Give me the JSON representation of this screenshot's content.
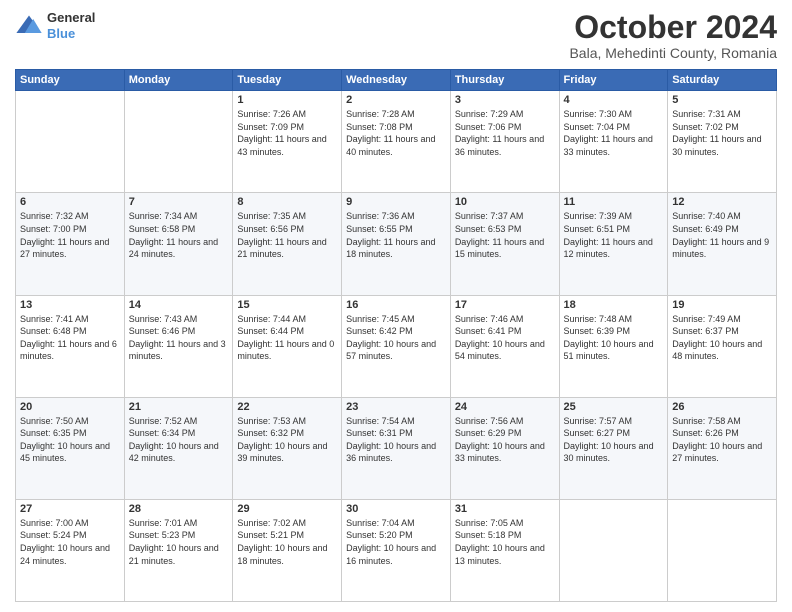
{
  "header": {
    "logo_line1": "General",
    "logo_line2": "Blue",
    "title": "October 2024",
    "location": "Bala, Mehedinti County, Romania"
  },
  "weekdays": [
    "Sunday",
    "Monday",
    "Tuesday",
    "Wednesday",
    "Thursday",
    "Friday",
    "Saturday"
  ],
  "weeks": [
    [
      {
        "day": "",
        "sunrise": "",
        "sunset": "",
        "daylight": ""
      },
      {
        "day": "",
        "sunrise": "",
        "sunset": "",
        "daylight": ""
      },
      {
        "day": "1",
        "sunrise": "Sunrise: 7:26 AM",
        "sunset": "Sunset: 7:09 PM",
        "daylight": "Daylight: 11 hours and 43 minutes."
      },
      {
        "day": "2",
        "sunrise": "Sunrise: 7:28 AM",
        "sunset": "Sunset: 7:08 PM",
        "daylight": "Daylight: 11 hours and 40 minutes."
      },
      {
        "day": "3",
        "sunrise": "Sunrise: 7:29 AM",
        "sunset": "Sunset: 7:06 PM",
        "daylight": "Daylight: 11 hours and 36 minutes."
      },
      {
        "day": "4",
        "sunrise": "Sunrise: 7:30 AM",
        "sunset": "Sunset: 7:04 PM",
        "daylight": "Daylight: 11 hours and 33 minutes."
      },
      {
        "day": "5",
        "sunrise": "Sunrise: 7:31 AM",
        "sunset": "Sunset: 7:02 PM",
        "daylight": "Daylight: 11 hours and 30 minutes."
      }
    ],
    [
      {
        "day": "6",
        "sunrise": "Sunrise: 7:32 AM",
        "sunset": "Sunset: 7:00 PM",
        "daylight": "Daylight: 11 hours and 27 minutes."
      },
      {
        "day": "7",
        "sunrise": "Sunrise: 7:34 AM",
        "sunset": "Sunset: 6:58 PM",
        "daylight": "Daylight: 11 hours and 24 minutes."
      },
      {
        "day": "8",
        "sunrise": "Sunrise: 7:35 AM",
        "sunset": "Sunset: 6:56 PM",
        "daylight": "Daylight: 11 hours and 21 minutes."
      },
      {
        "day": "9",
        "sunrise": "Sunrise: 7:36 AM",
        "sunset": "Sunset: 6:55 PM",
        "daylight": "Daylight: 11 hours and 18 minutes."
      },
      {
        "day": "10",
        "sunrise": "Sunrise: 7:37 AM",
        "sunset": "Sunset: 6:53 PM",
        "daylight": "Daylight: 11 hours and 15 minutes."
      },
      {
        "day": "11",
        "sunrise": "Sunrise: 7:39 AM",
        "sunset": "Sunset: 6:51 PM",
        "daylight": "Daylight: 11 hours and 12 minutes."
      },
      {
        "day": "12",
        "sunrise": "Sunrise: 7:40 AM",
        "sunset": "Sunset: 6:49 PM",
        "daylight": "Daylight: 11 hours and 9 minutes."
      }
    ],
    [
      {
        "day": "13",
        "sunrise": "Sunrise: 7:41 AM",
        "sunset": "Sunset: 6:48 PM",
        "daylight": "Daylight: 11 hours and 6 minutes."
      },
      {
        "day": "14",
        "sunrise": "Sunrise: 7:43 AM",
        "sunset": "Sunset: 6:46 PM",
        "daylight": "Daylight: 11 hours and 3 minutes."
      },
      {
        "day": "15",
        "sunrise": "Sunrise: 7:44 AM",
        "sunset": "Sunset: 6:44 PM",
        "daylight": "Daylight: 11 hours and 0 minutes."
      },
      {
        "day": "16",
        "sunrise": "Sunrise: 7:45 AM",
        "sunset": "Sunset: 6:42 PM",
        "daylight": "Daylight: 10 hours and 57 minutes."
      },
      {
        "day": "17",
        "sunrise": "Sunrise: 7:46 AM",
        "sunset": "Sunset: 6:41 PM",
        "daylight": "Daylight: 10 hours and 54 minutes."
      },
      {
        "day": "18",
        "sunrise": "Sunrise: 7:48 AM",
        "sunset": "Sunset: 6:39 PM",
        "daylight": "Daylight: 10 hours and 51 minutes."
      },
      {
        "day": "19",
        "sunrise": "Sunrise: 7:49 AM",
        "sunset": "Sunset: 6:37 PM",
        "daylight": "Daylight: 10 hours and 48 minutes."
      }
    ],
    [
      {
        "day": "20",
        "sunrise": "Sunrise: 7:50 AM",
        "sunset": "Sunset: 6:35 PM",
        "daylight": "Daylight: 10 hours and 45 minutes."
      },
      {
        "day": "21",
        "sunrise": "Sunrise: 7:52 AM",
        "sunset": "Sunset: 6:34 PM",
        "daylight": "Daylight: 10 hours and 42 minutes."
      },
      {
        "day": "22",
        "sunrise": "Sunrise: 7:53 AM",
        "sunset": "Sunset: 6:32 PM",
        "daylight": "Daylight: 10 hours and 39 minutes."
      },
      {
        "day": "23",
        "sunrise": "Sunrise: 7:54 AM",
        "sunset": "Sunset: 6:31 PM",
        "daylight": "Daylight: 10 hours and 36 minutes."
      },
      {
        "day": "24",
        "sunrise": "Sunrise: 7:56 AM",
        "sunset": "Sunset: 6:29 PM",
        "daylight": "Daylight: 10 hours and 33 minutes."
      },
      {
        "day": "25",
        "sunrise": "Sunrise: 7:57 AM",
        "sunset": "Sunset: 6:27 PM",
        "daylight": "Daylight: 10 hours and 30 minutes."
      },
      {
        "day": "26",
        "sunrise": "Sunrise: 7:58 AM",
        "sunset": "Sunset: 6:26 PM",
        "daylight": "Daylight: 10 hours and 27 minutes."
      }
    ],
    [
      {
        "day": "27",
        "sunrise": "Sunrise: 7:00 AM",
        "sunset": "Sunset: 5:24 PM",
        "daylight": "Daylight: 10 hours and 24 minutes."
      },
      {
        "day": "28",
        "sunrise": "Sunrise: 7:01 AM",
        "sunset": "Sunset: 5:23 PM",
        "daylight": "Daylight: 10 hours and 21 minutes."
      },
      {
        "day": "29",
        "sunrise": "Sunrise: 7:02 AM",
        "sunset": "Sunset: 5:21 PM",
        "daylight": "Daylight: 10 hours and 18 minutes."
      },
      {
        "day": "30",
        "sunrise": "Sunrise: 7:04 AM",
        "sunset": "Sunset: 5:20 PM",
        "daylight": "Daylight: 10 hours and 16 minutes."
      },
      {
        "day": "31",
        "sunrise": "Sunrise: 7:05 AM",
        "sunset": "Sunset: 5:18 PM",
        "daylight": "Daylight: 10 hours and 13 minutes."
      },
      {
        "day": "",
        "sunrise": "",
        "sunset": "",
        "daylight": ""
      },
      {
        "day": "",
        "sunrise": "",
        "sunset": "",
        "daylight": ""
      }
    ]
  ]
}
